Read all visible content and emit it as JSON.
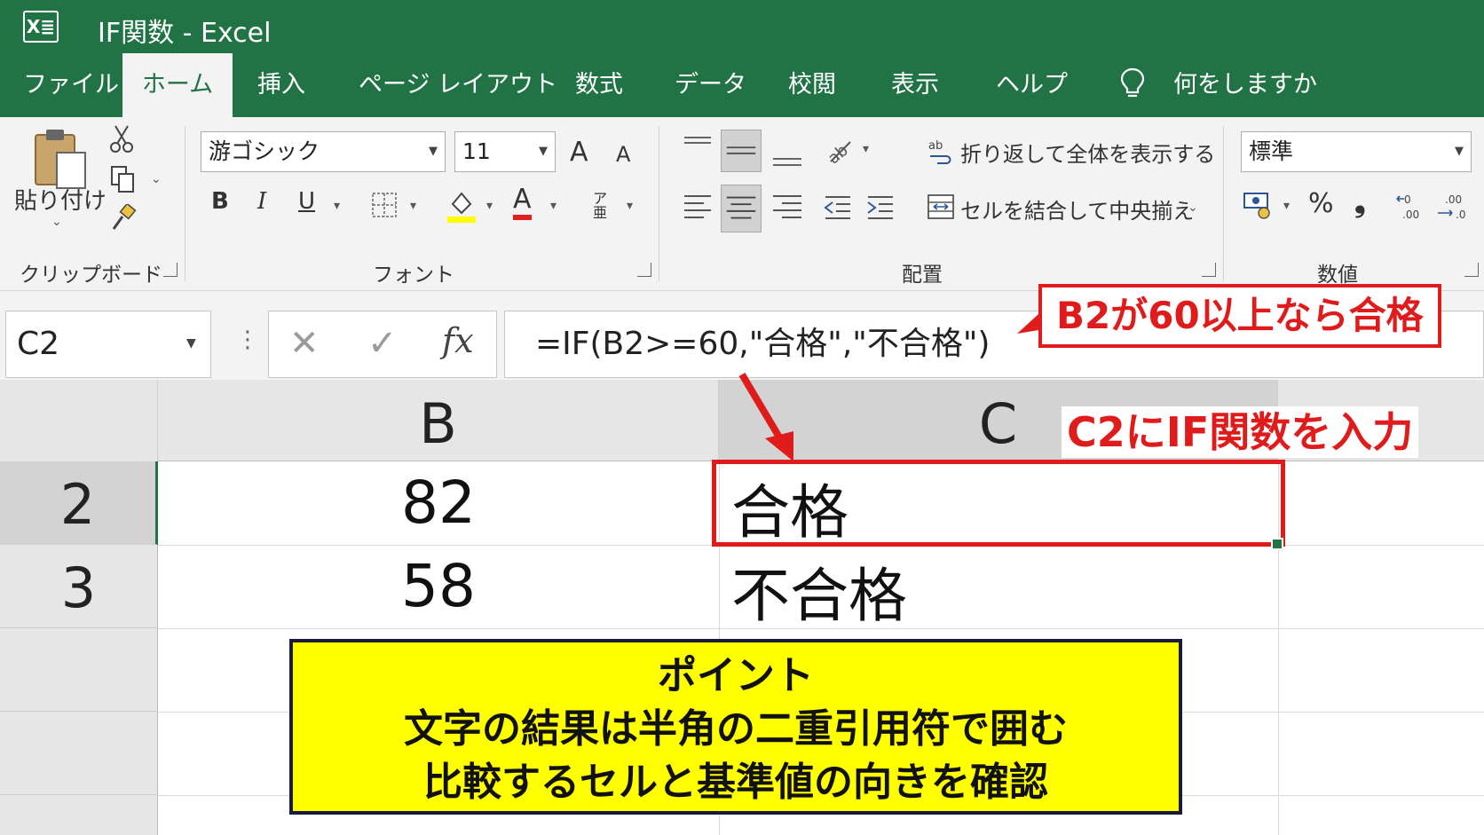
{
  "window": {
    "app_logo": "X≣",
    "title": "IF関数  -  Excel"
  },
  "tabs": [
    {
      "label": "ファイル"
    },
    {
      "label": "ホーム",
      "active": true
    },
    {
      "label": "挿入"
    },
    {
      "label": "ページ レイアウト"
    },
    {
      "label": "数式"
    },
    {
      "label": "データ"
    },
    {
      "label": "校閲"
    },
    {
      "label": "表示"
    },
    {
      "label": "ヘルプ"
    }
  ],
  "tell_me": {
    "icon": "lightbulb-icon",
    "label": "何をしますか"
  },
  "ribbon": {
    "clipboard": {
      "paste_label": "貼り付け",
      "group_label": "クリップボード"
    },
    "font": {
      "font_name": "游ゴシック",
      "font_size": "11",
      "bold": "B",
      "italic": "I",
      "underline": "U",
      "grow_font": "A",
      "shrink_font": "A",
      "font_color_letter": "A",
      "group_label": "フォント"
    },
    "alignment": {
      "wrap_text": "折り返して全体を表示する",
      "merge_center": "セルを結合して中央揃え",
      "group_label": "配置"
    },
    "number": {
      "format": "標準",
      "percent": "%",
      "comma": "❟",
      "group_label": "数値"
    }
  },
  "formula_bar": {
    "name_box": "C2",
    "formula": "=IF(B2>=60,\"合格\",\"不合格\")",
    "fx": "fx",
    "cancel": "✕",
    "enter": "✓"
  },
  "grid": {
    "columns": [
      "B",
      "C"
    ],
    "rows": [
      {
        "row": "2",
        "B": "82",
        "C": "合格"
      },
      {
        "row": "3",
        "B": "58",
        "C": "不合格"
      }
    ],
    "selected_cell": "C2"
  },
  "annotations": {
    "formula_callout": "B2が60以上なら合格",
    "cell_callout": "C2にIF関数を入力",
    "point_title": "ポイント",
    "point_line1": "文字の結果は半角の二重引用符で囲む",
    "point_line2": "比較するセルと基準値の向きを確認"
  },
  "colors": {
    "excel_green": "#217346",
    "annotation_red": "#e01b1b",
    "point_yellow": "#ffff00"
  }
}
